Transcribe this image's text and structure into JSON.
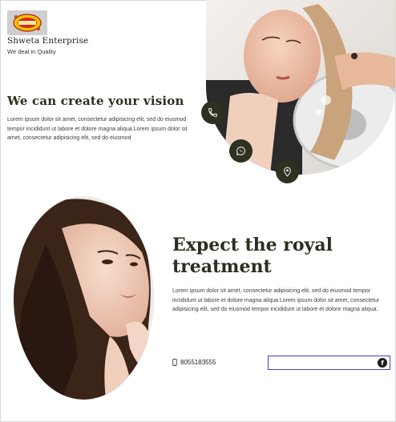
{
  "brand": {
    "name": "Shweta Enterprise",
    "tagline": "We deal in Quality"
  },
  "hero": {
    "title": "We can create your vision",
    "body": "Lorem ipsum dolor sit amet, consectetur adipisicing elit, sed do eiusmod tempor incididunt ut labore et dolore magna aliqua.Lorem ipsum dolor sit amet, consectetur adipisicing elit, sed do eiusmod"
  },
  "contact_buttons": {
    "phone_icon": "phone-icon",
    "whatsapp_icon": "whatsapp-icon",
    "location_icon": "location-pin-icon",
    "button_color": "#2e3020"
  },
  "feature": {
    "title": "Expect the royal treatment",
    "body": "Lorem ipsum dolor sit amet, consectetur adipisicing elit, sed do eiusmod tempor incididunt ut labore et dolore magna aliqua.Lorem ipsum dolor sit amet, consectetur adipisicing elit, sed do eiusmod tempor incididunt ut labore et dolore magna aliqua.",
    "phone": "8055183555"
  },
  "social": {
    "facebook_icon": "facebook-icon"
  },
  "colors": {
    "heading": "#2a2f1e",
    "accent_border": "#3c43c8"
  }
}
